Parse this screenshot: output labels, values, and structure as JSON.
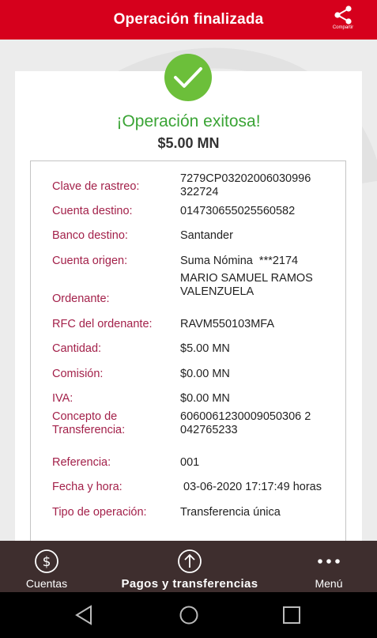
{
  "header": {
    "title": "Operación finalizada",
    "share_label": "Compartir"
  },
  "result": {
    "title": "¡Operación exitosa!",
    "amount": "$5.00 MN"
  },
  "details": [
    {
      "label": "Clave de rastreo:",
      "value": "7279CP03202006030996\n322724"
    },
    {
      "label": "Cuenta destino:",
      "value": "014730655025560582"
    },
    {
      "label": "Banco destino:",
      "value": "Santander"
    },
    {
      "label": "Cuenta origen:",
      "value": "Suma Nómina  ***2174"
    },
    {
      "label": "Ordenante:",
      "value": "MARIO SAMUEL RAMOS\nVALENZUELA"
    },
    {
      "label": "RFC del ordenante:",
      "value": "RAVM550103MFA"
    },
    {
      "label": "Cantidad:",
      "value": "$5.00 MN"
    },
    {
      "label": "Comisión:",
      "value": "$0.00 MN"
    },
    {
      "label": "IVA:",
      "value": "$0.00 MN"
    },
    {
      "label": "Concepto de\nTransferencia:",
      "value": "6060061230009050306 2\n042765233"
    },
    {
      "label": "Referencia:",
      "value": "001"
    },
    {
      "label": "Fecha y hora:",
      "value": " 03-06-2020 17:17:49 horas"
    },
    {
      "label": "Tipo de operación:",
      "value": "Transferencia única"
    }
  ],
  "nav": {
    "cuentas": "Cuentas",
    "pagos": "Pagos y transferencias",
    "menu": "Menú"
  },
  "colors": {
    "header": "#d6001c",
    "success": "#3aa435",
    "label": "#a3214a",
    "nav_bg": "#3e2e2e"
  },
  "icons": {
    "share": "share-icon",
    "check": "check-icon",
    "cuentas": "dollar-circle-icon",
    "pagos": "arrow-up-circle-icon",
    "menu": "dots-icon"
  }
}
